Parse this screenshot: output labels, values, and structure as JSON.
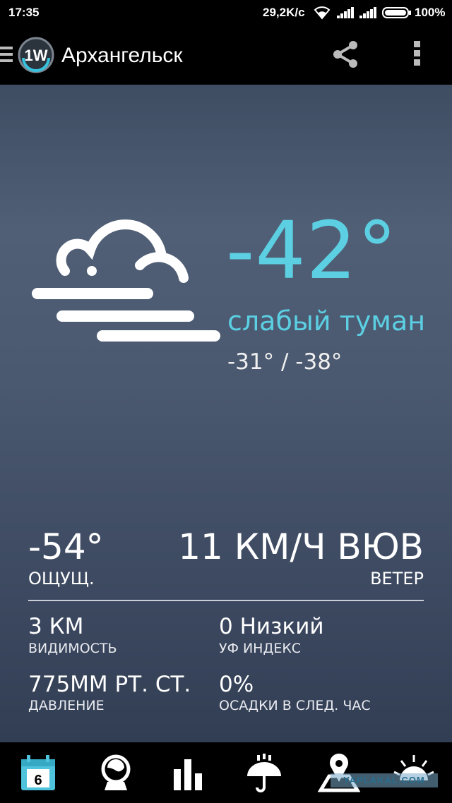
{
  "status_bar": {
    "time": "17:35",
    "network_speed": "29,2K/c",
    "battery_percent": "100%",
    "battery_level": 1.0
  },
  "app_bar": {
    "logo_text": "1W",
    "city": "Архангельск"
  },
  "current": {
    "temperature": "-42°",
    "condition": "слабый туман",
    "high_low": "-31° / -38°",
    "feels_like_value": "-54°",
    "feels_like_label": "ОЩУЩ.",
    "wind_value": "11 КМ/Ч ВЮВ",
    "wind_label": "ВЕТЕР"
  },
  "stats": [
    {
      "value": "3 КМ",
      "label": "ВИДИМОСТЬ"
    },
    {
      "value": "0 Низкий",
      "label": "УФ ИНДЕКС"
    },
    {
      "value": "775ММ РТ. СТ.",
      "label": "ДАВЛЕНИЕ"
    },
    {
      "value": "0%",
      "label": "ОСАДКИ В СЛЕД. ЧАС"
    }
  ],
  "bottom_nav": {
    "calendar_day": "6",
    "items": [
      "calendar-icon",
      "radar-globe-icon",
      "chart-icon",
      "precipitation-umbrella-icon",
      "map-pin-icon",
      "sun-icon"
    ]
  },
  "watermark": "YAPLAKAL.COM",
  "colors": {
    "accent": "#5ccfe2",
    "background_top": "#505f76",
    "background_bottom": "#323e54"
  }
}
